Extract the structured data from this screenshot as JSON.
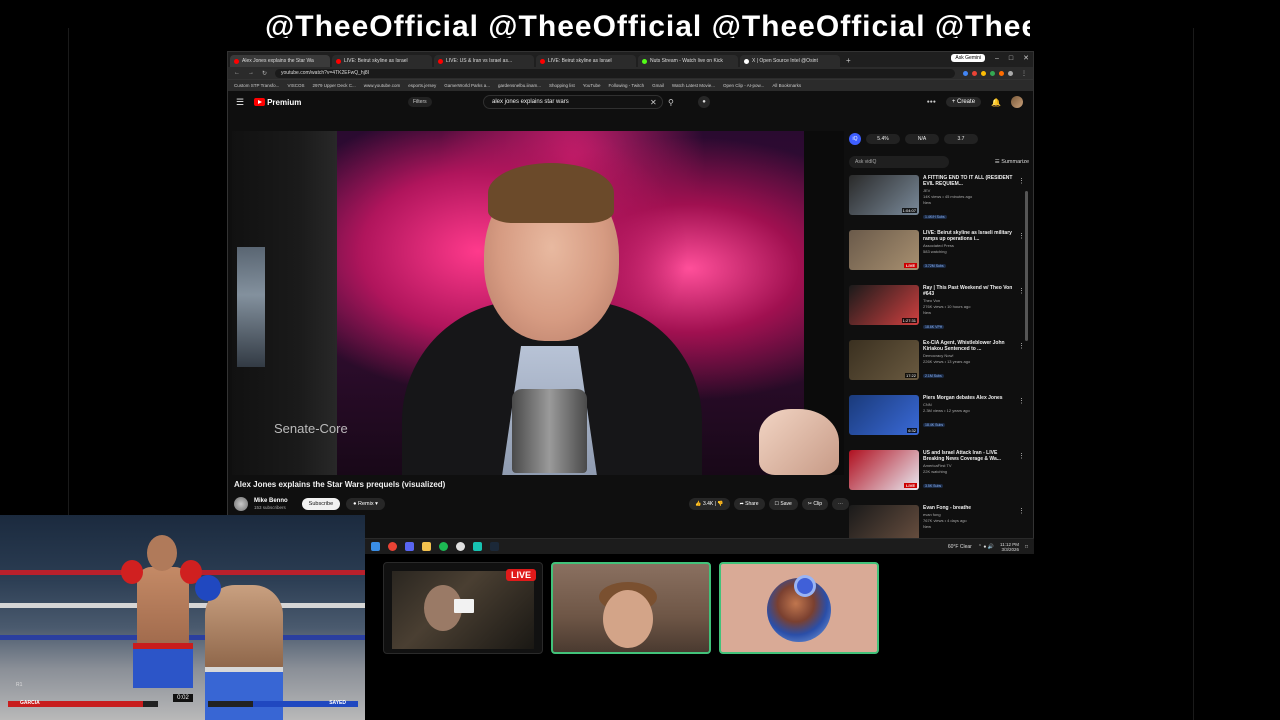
{
  "banner": {
    "text": "@TheeOfficial @TheeOfficial @TheeOfficial @Thee"
  },
  "browser": {
    "tabs": [
      {
        "label": "Alex Jones explains the Star Wa",
        "color": "#ff0000",
        "active": true
      },
      {
        "label": "LIVE: Beirut skyline as Israel",
        "color": "#ff0000"
      },
      {
        "label": "LIVE: US & Iran vs Israel as...",
        "color": "#ff0000"
      },
      {
        "label": "LIVE: Beirut skyline as Israel",
        "color": "#ff0000"
      },
      {
        "label": "Nuts Stream - Watch live on Kick",
        "color": "#53fc18"
      },
      {
        "label": "X | Open Source Intel @Osint",
        "color": "#ffffff"
      }
    ],
    "new_tab": "+",
    "ask_gemini": "Ask Gemini",
    "url": "youtube.com/watch?v=4TK2EFwQ_hj8I",
    "bookmarks": [
      "Custom STP Transfo...",
      "VISCOS",
      "2979 Upper Deck C...",
      "www.youtube.com",
      "esports.jersey",
      "GamerWorld Parks a...",
      "gardensnelbu.iinam...",
      "Shopping list",
      "YouTube",
      "Following - Twitch",
      "Gmail",
      "Watch Latest Movie...",
      "Open Clip - AI-pow...",
      "All Bookmarks"
    ]
  },
  "youtube": {
    "logo": "Premium",
    "filters": "Filters",
    "search_query": "alex jones explains star wars",
    "create": "Create",
    "video": {
      "watermark": "Senate-Core",
      "title": "Alex Jones explains the Star Wars prequels (visualized)",
      "channel": "Mike Benno",
      "subscribers": "153 subscribers",
      "subscribe": "Subscribe",
      "remix": "Remix",
      "likes": "3.4K",
      "share": "Share",
      "save": "Save",
      "clip": "Clip"
    },
    "vidiq": {
      "stats": [
        "5.4%",
        "N/A",
        "3.7"
      ],
      "ask": "Ask vidIQ",
      "summarize": "Summarize"
    },
    "recommendations": [
      {
        "title": "A FITTING END TO IT ALL (RESIDENT EVIL REQUIEM...",
        "channel": "JEV",
        "meta": "14K views • 45 minutes ago",
        "tag": "New",
        "badge": "1.4K/H Subs",
        "duration": "1:04:07",
        "thumb": [
          "#2a2a2a",
          "#7a8a9a"
        ]
      },
      {
        "title": "LIVE: Beirut skyline as Israeli military ramps up operations i...",
        "channel": "Associated Press",
        "meta": "583 watching",
        "tag": "",
        "badge": "3.72M Subs",
        "duration": "LIVE",
        "thumb": [
          "#6a5a4a",
          "#a89070"
        ]
      },
      {
        "title": "Ray | This Past Weekend w/ Theo Von #643",
        "channel": "Theo Von",
        "meta": "276K views • 10 hours ago",
        "tag": "New",
        "badge": "18.6K VPH",
        "duration": "1:27:31",
        "thumb": [
          "#1a1a1a",
          "#d04040"
        ]
      },
      {
        "title": "Ex-CIA Agent, Whistleblower John Kiriakou Sentenced to ...",
        "channel": "Democracy Now!",
        "meta": "226K views • 13 years ago",
        "tag": "",
        "badge": "2.1M Subs",
        "duration": "17:22",
        "thumb": [
          "#3a3020",
          "#6a5a40"
        ]
      },
      {
        "title": "Piers Morgan debates Alex Jones",
        "channel": "CNN",
        "meta": "2.3M views • 12 years ago",
        "tag": "",
        "badge": "18.4K Subs",
        "duration": "6:32",
        "thumb": [
          "#1a3a7a",
          "#3a6ad8"
        ]
      },
      {
        "title": "US and Israel Attack Iran - LIVE Breaking News Coverage & Wa...",
        "channel": "AmericaFirst TV",
        "meta": "22K watching",
        "tag": "",
        "badge": "3.5K Subs",
        "duration": "LIVE",
        "thumb": [
          "#b01020",
          "#e8e8f0"
        ]
      },
      {
        "title": "Evan Fong - breathe",
        "channel": "evan fong",
        "meta": "767K views • 4 days ago",
        "tag": "New",
        "badge": "",
        "duration": "2:48",
        "thumb": [
          "#1a1a1a",
          "#6a5040"
        ]
      }
    ]
  },
  "taskbar": {
    "weather": "60°F Clear",
    "time": "11:12 PM",
    "date": "3/3/2026"
  },
  "game": {
    "fighter_left": "GARCIA",
    "fighter_right": "SAYED",
    "timer": "0:02",
    "round": "R1",
    "health_left": 0.9,
    "health_right": 0.7
  },
  "cams": {
    "live_label": "LIVE"
  }
}
